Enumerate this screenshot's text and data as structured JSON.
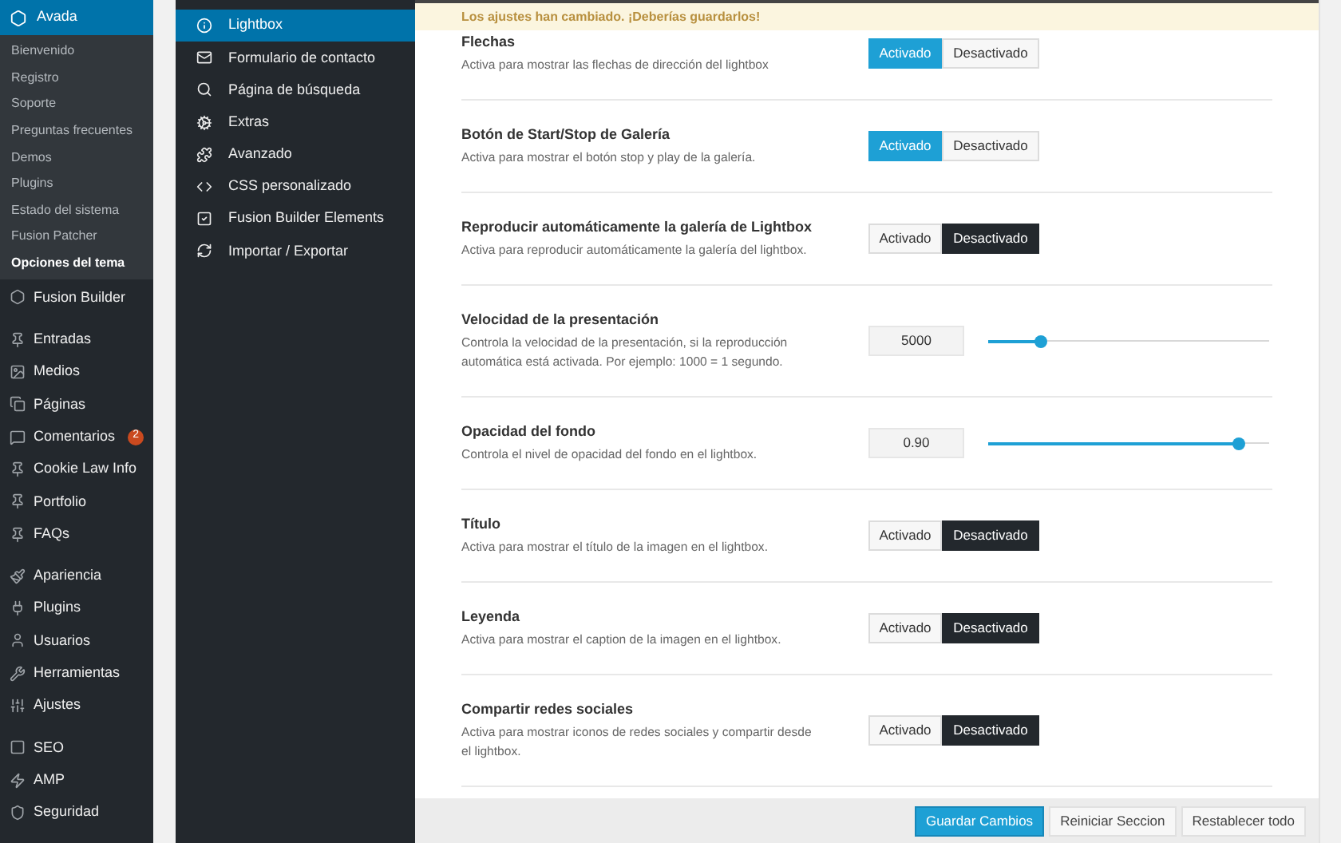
{
  "admin_menu": {
    "header": {
      "label": "Avada",
      "selected": true
    },
    "submenu": [
      {
        "label": "Bienvenido",
        "selected": false
      },
      {
        "label": "Registro",
        "selected": false
      },
      {
        "label": "Soporte",
        "selected": false
      },
      {
        "label": "Preguntas frecuentes",
        "selected": false
      },
      {
        "label": "Demos",
        "selected": false
      },
      {
        "label": "Plugins",
        "selected": false
      },
      {
        "label": "Estado del sistema",
        "selected": false
      },
      {
        "label": "Fusion Patcher",
        "selected": false
      },
      {
        "label": "Opciones del tema",
        "selected": true
      }
    ],
    "groups": [
      [
        {
          "label": "Fusion Builder"
        }
      ],
      [
        {
          "label": "Entradas"
        },
        {
          "label": "Medios"
        },
        {
          "label": "Páginas"
        },
        {
          "label": "Comentarios",
          "badge": "2"
        },
        {
          "label": "Cookie Law Info"
        },
        {
          "label": "Portfolio"
        },
        {
          "label": "FAQs"
        }
      ],
      [
        {
          "label": "Apariencia"
        },
        {
          "label": "Plugins"
        },
        {
          "label": "Usuarios"
        },
        {
          "label": "Herramientas"
        },
        {
          "label": "Ajustes"
        }
      ],
      [
        {
          "label": "SEO"
        },
        {
          "label": "AMP"
        },
        {
          "label": "Seguridad"
        }
      ]
    ]
  },
  "options_nav": [
    {
      "label": "Lightbox",
      "selected": true
    },
    {
      "label": "Formulario de contacto",
      "selected": false
    },
    {
      "label": "Página de búsqueda",
      "selected": false
    },
    {
      "label": "Extras",
      "selected": false
    },
    {
      "label": "Avanzado",
      "selected": false
    },
    {
      "label": "CSS personalizado",
      "selected": false
    },
    {
      "label": "Fusion Builder Elements",
      "selected": false
    },
    {
      "label": "Importar / Exportar",
      "selected": false
    }
  ],
  "notice": "Los ajustes han cambiado. ¡Deberías guardarlos!",
  "settings": [
    {
      "kind": "toggle",
      "title": "Flechas",
      "description": "Activa para mostrar las flechas de dirección del lightbox",
      "options": [
        {
          "label": "Activado",
          "selected": true
        },
        {
          "label": "Desactivado",
          "selected": false
        }
      ]
    },
    {
      "kind": "toggle",
      "title": "Botón de Start/Stop de Galería",
      "description": "Activa para mostrar el botón stop y play de la galería.",
      "options": [
        {
          "label": "Activado",
          "selected": true
        },
        {
          "label": "Desactivado",
          "selected": false
        }
      ]
    },
    {
      "kind": "toggle",
      "title": "Reproducir automáticamente la galería de Lightbox",
      "description": "Activa para reproducir automáticamente la galería del lightbox.",
      "options": [
        {
          "label": "Activado",
          "selected": false
        },
        {
          "label": "Desactivado",
          "selected": true
        }
      ]
    },
    {
      "kind": "slider",
      "title": "Velocidad de la presentación",
      "description": "Controla la velocidad de la presentación, si la reproducción automática está activada. Por ejemplo: 1000 = 1 segundo.",
      "value": "5000",
      "level": 0.19
    },
    {
      "kind": "slider",
      "title": "Opacidad del fondo",
      "description": "Controla el nivel de opacidad del fondo en el lightbox.",
      "value": "0.90",
      "level": 0.89
    },
    {
      "kind": "toggle",
      "title": "Título",
      "description": "Activa para mostrar el título de la imagen en el lightbox.",
      "options": [
        {
          "label": "Activado",
          "selected": false
        },
        {
          "label": "Desactivado",
          "selected": true
        }
      ]
    },
    {
      "kind": "toggle",
      "title": "Leyenda",
      "description": "Activa para mostrar el caption de la imagen en el lightbox.",
      "options": [
        {
          "label": "Activado",
          "selected": false
        },
        {
          "label": "Desactivado",
          "selected": true
        }
      ]
    },
    {
      "kind": "toggle",
      "title": "Compartir redes sociales",
      "description": "Activa para mostrar iconos de redes sociales y compartir desde el lightbox.",
      "options": [
        {
          "label": "Activado",
          "selected": false
        },
        {
          "label": "Desactivado",
          "selected": true
        }
      ]
    }
  ],
  "footer_buttons": [
    {
      "label": "Guardar Cambios",
      "kind": "primary"
    },
    {
      "label": "Reiniciar Seccion",
      "kind": "secondary"
    },
    {
      "label": "Restablecer todo",
      "kind": "secondary"
    }
  ]
}
